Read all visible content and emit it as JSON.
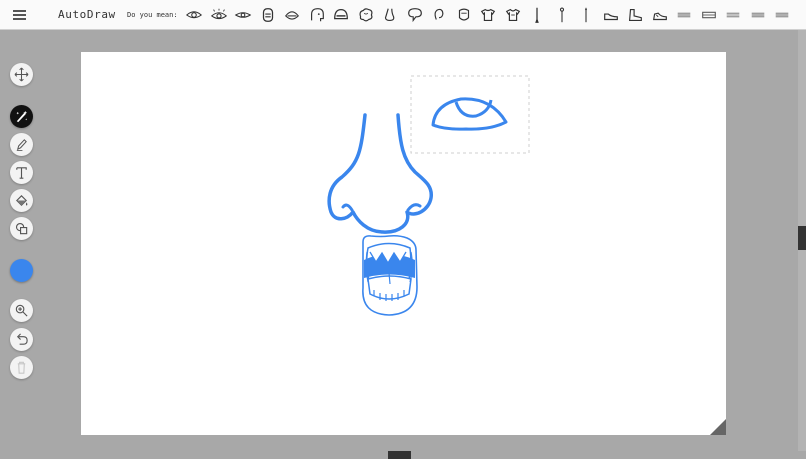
{
  "app": {
    "title": "AutoDraw"
  },
  "suggestion_bar": {
    "label": "Do you mean:",
    "items": [
      "eye-icon",
      "eye-lashes-icon",
      "eye-simple-icon",
      "face-mask-icon",
      "mouth-icon",
      "head-profile-icon",
      "helmet-icon",
      "brain-icon",
      "nose-icon",
      "speech-bubble-icon",
      "ear-icon",
      "face-icon",
      "shirt-icon",
      "tshirt-icon",
      "pen-icon",
      "pin-icon",
      "needle-icon",
      "shoe-icon",
      "boot-icon",
      "sneaker-icon",
      "lines-icon",
      "lines-bold-icon",
      "lines-thin-icon",
      "lines-double-icon",
      "lines-stack-icon"
    ]
  },
  "toolbar": {
    "tools": [
      {
        "name": "move-tool",
        "icon": "move-arrows-icon"
      },
      {
        "name": "autodraw-tool",
        "icon": "autodraw-icon",
        "active": true
      },
      {
        "name": "draw-tool",
        "icon": "pencil-icon"
      },
      {
        "name": "type-tool",
        "icon": "text-icon"
      },
      {
        "name": "fill-tool",
        "icon": "paint-bucket-icon"
      },
      {
        "name": "shape-tool",
        "icon": "shapes-icon"
      },
      {
        "name": "color-tool",
        "icon": "color-swatch"
      },
      {
        "name": "zoom-tool",
        "icon": "zoom-icon"
      },
      {
        "name": "undo-tool",
        "icon": "undo-icon"
      },
      {
        "name": "delete-tool",
        "icon": "trash-icon"
      }
    ]
  },
  "colors": {
    "stroke": "#3a86ed",
    "canvas": "#ffffff",
    "workspace": "#a8a8a8"
  }
}
